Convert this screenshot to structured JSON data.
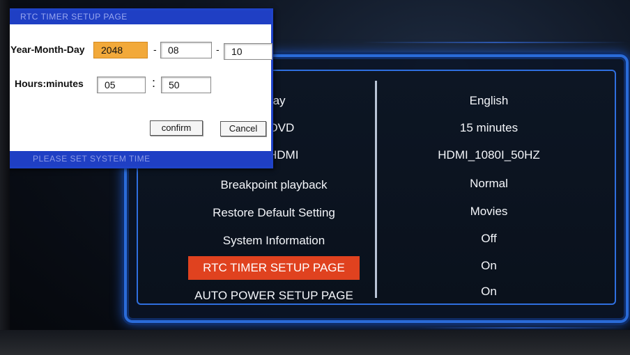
{
  "menu": {
    "left_items": [
      {
        "label": "Play",
        "selected": false
      },
      {
        "label": "ay DVD",
        "selected": false
      },
      {
        "label": "ect HDMI",
        "selected": false
      },
      {
        "label": "Breakpoint playback",
        "selected": false
      },
      {
        "label": "Restore Default Setting",
        "selected": false
      },
      {
        "label": "System Information",
        "selected": false
      },
      {
        "label": "RTC TIMER SETUP PAGE",
        "selected": true
      },
      {
        "label": "AUTO POWER SETUP PAGE",
        "selected": false
      }
    ],
    "right_values": [
      "English",
      "15 minutes",
      "HDMI_1080I_50HZ",
      "Normal",
      "Movies",
      "Off",
      "On",
      "On"
    ],
    "selected_color": "#e0421f",
    "frame_color": "#2a6bd8"
  },
  "rtc_dialog": {
    "title": "RTC TIMER SETUP PAGE",
    "date_label": "Year-Month-Day",
    "year": "2048",
    "month": "08",
    "day": "10",
    "date_separator": "-",
    "time_label": "Hours:minutes",
    "hours": "05",
    "minutes": "50",
    "time_separator": ":",
    "confirm_label": "confirm",
    "cancel_label": "Cancel",
    "footer": "PLEASE SET SYSTEM TIME",
    "active_field_color": "#f2a93a",
    "bar_color": "#1f3fc4"
  }
}
